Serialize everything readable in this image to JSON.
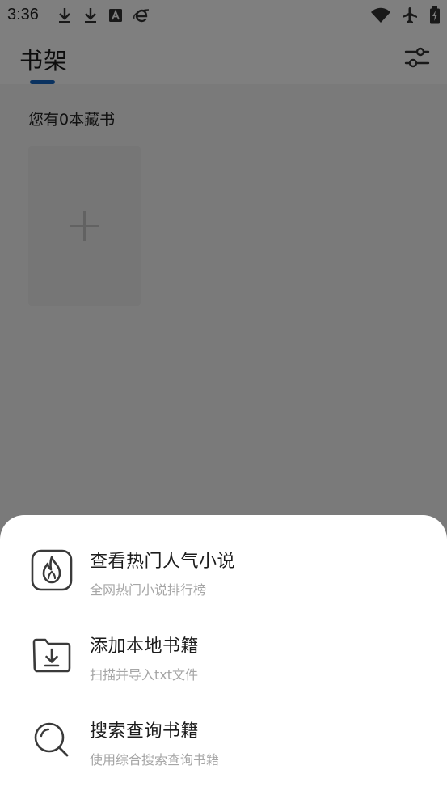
{
  "status_bar": {
    "time": "3:36",
    "left_icons": [
      "download-icon",
      "download-icon",
      "font-a-icon",
      "browser-e-icon"
    ],
    "right_icons": [
      "wifi-icon",
      "airplane-icon",
      "battery-charging-icon"
    ]
  },
  "header": {
    "title": "书架",
    "settings_icon": "sliders-icon",
    "accent_color": "#1565c0"
  },
  "shelf": {
    "book_count_text": "您有0本藏书",
    "add_icon": "plus-icon"
  },
  "bottom_sheet": {
    "items": [
      {
        "title": "查看热门人气小说",
        "subtitle": "全网热门小说排行榜",
        "icon": "fire-icon"
      },
      {
        "title": "添加本地书籍",
        "subtitle": "扫描并导入txt文件",
        "icon": "folder-download-icon"
      },
      {
        "title": "搜索查询书籍",
        "subtitle": "使用综合搜索查询书籍",
        "icon": "search-icon"
      }
    ]
  }
}
